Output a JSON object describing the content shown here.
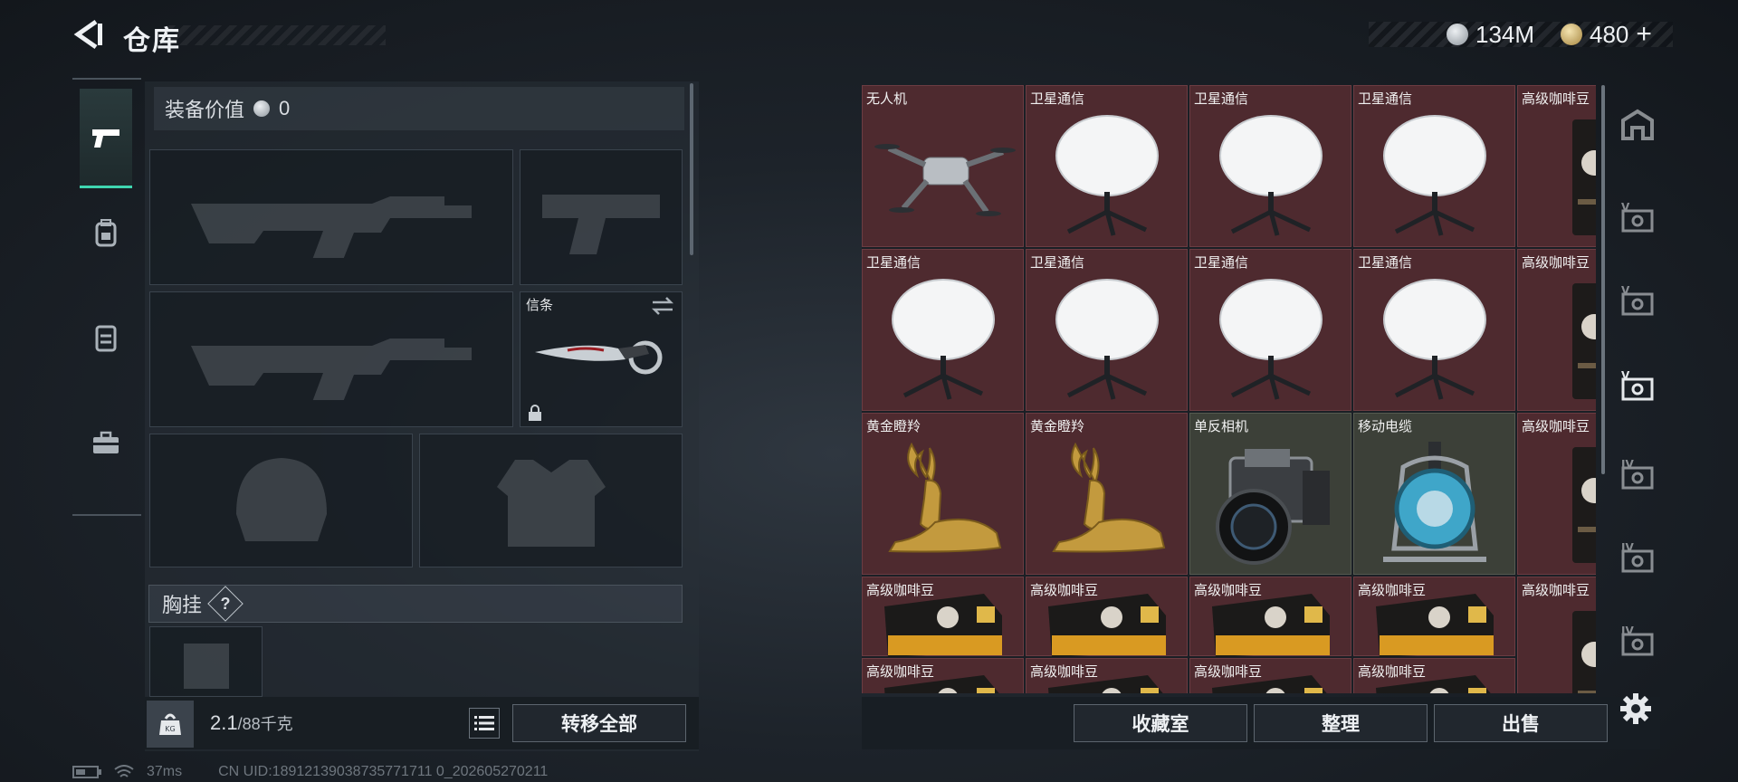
{
  "header": {
    "title": "仓库",
    "currency_1": {
      "icon": "silver-coin-icon",
      "amount": "134M"
    },
    "currency_2": {
      "icon": "gold-coin-icon",
      "amount": "480",
      "add_label": "+"
    }
  },
  "left_tabs": [
    {
      "icon": "pistol-icon",
      "active": true
    },
    {
      "icon": "backpack-icon",
      "active": false
    },
    {
      "icon": "vest-icon",
      "active": false
    },
    {
      "icon": "toolbox-icon",
      "active": false
    }
  ],
  "equipment": {
    "value_label": "装备价值",
    "value": "0",
    "melee_slot": {
      "label": "信条"
    },
    "chest_rig_label": "胸挂",
    "chest_rig_help": "?",
    "weight": "2.1",
    "weight_capacity": "/88千克",
    "transfer_all_label": "转移全部"
  },
  "stash": {
    "items": [
      {
        "name": "无人机",
        "type": "drone"
      },
      {
        "name": "卫星通信",
        "type": "satellite"
      },
      {
        "name": "卫星通信",
        "type": "satellite"
      },
      {
        "name": "卫星通信",
        "type": "satellite"
      },
      {
        "name": "高级咖啡豆",
        "type": "coffee-bag"
      },
      {
        "name": "卫星通信",
        "type": "satellite"
      },
      {
        "name": "卫星通信",
        "type": "satellite"
      },
      {
        "name": "卫星通信",
        "type": "satellite"
      },
      {
        "name": "卫星通信",
        "type": "satellite"
      },
      {
        "name": "高级咖啡豆",
        "type": "coffee-bag"
      },
      {
        "name": "黄金瞪羚",
        "type": "gazelle"
      },
      {
        "name": "黄金瞪羚",
        "type": "gazelle"
      },
      {
        "name": "单反相机",
        "type": "camera"
      },
      {
        "name": "移动电缆",
        "type": "cable-reel"
      },
      {
        "name": "高级咖啡豆",
        "type": "coffee-bag"
      },
      {
        "name": "高级咖啡豆",
        "type": "coffee-pack"
      },
      {
        "name": "高级咖啡豆",
        "type": "coffee-pack"
      },
      {
        "name": "高级咖啡豆",
        "type": "coffee-pack"
      },
      {
        "name": "高级咖啡豆",
        "type": "coffee-pack"
      },
      {
        "name": "高级咖啡豆",
        "type": "coffee-bag"
      },
      {
        "name": "高级咖啡豆",
        "type": "coffee-pack"
      },
      {
        "name": "高级咖啡豆",
        "type": "coffee-pack"
      },
      {
        "name": "高级咖啡豆",
        "type": "coffee-pack"
      },
      {
        "name": "高级咖啡豆",
        "type": "coffee-pack"
      }
    ],
    "collection_label": "收藏室",
    "sort_label": "整理",
    "sell_label": "出售"
  },
  "right_tabs": [
    {
      "icon": "home-stash-icon",
      "label": ""
    },
    {
      "icon": "tier-v-case-icon",
      "label": "V"
    },
    {
      "icon": "tier-v-case-icon",
      "label": "V"
    },
    {
      "icon": "tier-v-case-icon",
      "label": "V"
    },
    {
      "icon": "tier-iv-case-icon",
      "label": "IV"
    },
    {
      "icon": "tier-iv-case-icon",
      "label": "IV"
    },
    {
      "icon": "tier-iv-case-icon",
      "label": "IV"
    }
  ],
  "status": {
    "ping": "37ms",
    "uid": "CN UID:18912139038735771711 0_202605270211"
  },
  "colors": {
    "accent": "#3fd6b0",
    "cell_red": "#4e2a2f"
  }
}
